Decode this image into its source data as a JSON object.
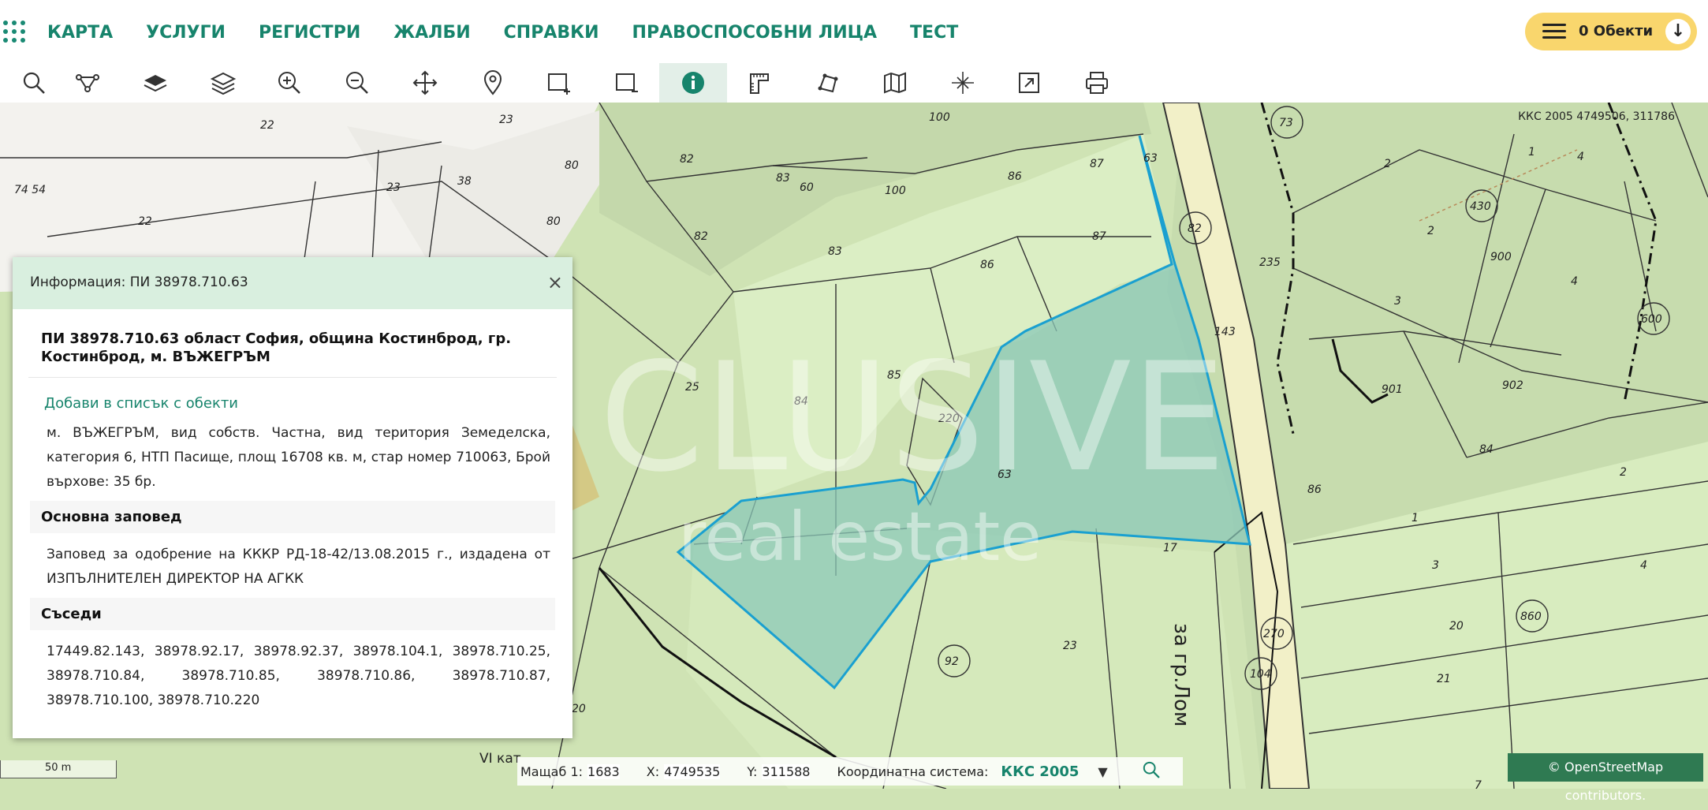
{
  "nav": {
    "items": [
      "КАРТА",
      "УСЛУГИ",
      "РЕГИСТРИ",
      "ЖАЛБИ",
      "СПРАВКИ",
      "ПРАВОСПОСОБНИ ЛИЦА",
      "ТЕСТ"
    ],
    "objects_label": "0 Обекти"
  },
  "toolbar": {
    "tools": [
      "search-icon",
      "route-icon",
      "layer-icon",
      "layers-icon",
      "zoom-in-icon",
      "zoom-out-icon",
      "pan-icon",
      "location-pin-icon",
      "add-rectangle-icon",
      "remove-rectangle-icon",
      "info-icon",
      "measure-icon",
      "polygon-icon",
      "map-icon",
      "crosshair-icon",
      "export-icon",
      "print-icon"
    ],
    "active_tool": "info-icon"
  },
  "map": {
    "coords_label": "ККС 2005 4749506, 311786",
    "parcel_numbers": [
      "22",
      "23",
      "80",
      "82",
      "83",
      "60",
      "100",
      "86",
      "87",
      "63",
      "73",
      "82",
      "235",
      "430",
      "900",
      "600",
      "901",
      "902",
      "84",
      "86",
      "1",
      "3",
      "2",
      "4",
      "83",
      "85",
      "84",
      "25",
      "220",
      "63",
      "17",
      "92",
      "23",
      "270",
      "104",
      "860",
      "20",
      "21",
      "143",
      "38",
      "74 54",
      "7"
    ],
    "road_label": "за гр.Лом",
    "watermark": "INCLUSIVE real estate"
  },
  "info_panel": {
    "header": "Информация: ПИ 38978.710.63",
    "close": "×",
    "title": "ПИ 38978.710.63 област София, община Костинброд, гр. Костинброд, м. ВЪЖЕГРЪМ",
    "add_link": "Добави в списък с обекти",
    "description": "м. ВЪЖЕГРЪМ, вид собств. Частна, вид територия Земеделска, категория 6, НТП Пасище, площ 16708 кв. м, стар номер 710063, Брой върхове: 35 бр.",
    "order_heading": "Основна заповед",
    "order_text": "Заповед за одобрение на КККР РД-18-42/13.08.2015 г., издадена от ИЗПЪЛНИТЕЛЕН ДИРЕКТОР НА АГКК",
    "neighbors_heading": "Съседи",
    "neighbors": "17449.82.143, 38978.92.17, 38978.92.37, 38978.104.1, 38978.710.25, 38978.710.84, 38978.710.85, 38978.710.86, 38978.710.87, 38978.710.100, 38978.710.220"
  },
  "status_bar": {
    "scale_label": "50 m",
    "scale_text": "Мащаб 1:",
    "scale_value": "1683",
    "x_label": "X:",
    "x_value": "4749535",
    "y_label": "Y:",
    "y_value": "311588",
    "coord_system_label": "Координатна система:",
    "coord_system_value": "ККС 2005",
    "partial_label": "VI кат",
    "osm": "© OpenStreetMap contributors."
  },
  "colors": {
    "accent": "#17846c",
    "selection_fill": "#8bc8b8",
    "selection_stroke": "#1aa0d0",
    "objects_button": "#f9d66d"
  }
}
